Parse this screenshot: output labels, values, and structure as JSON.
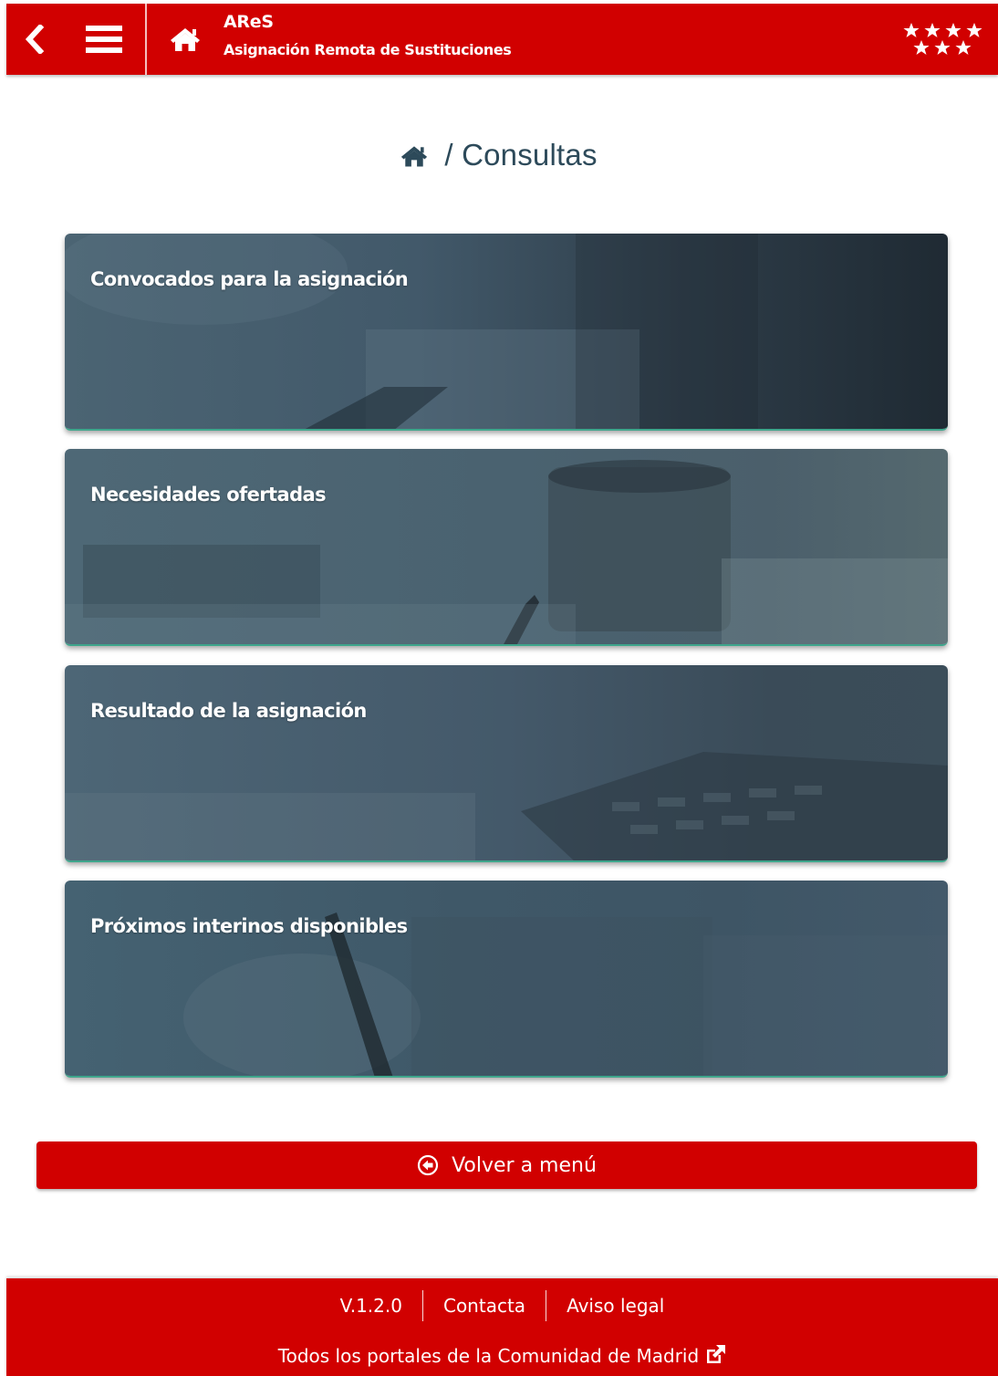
{
  "header": {
    "app_name": "AReS",
    "app_subtitle": "Asignación Remota de Sustituciones",
    "icons": [
      "chevron-left-icon",
      "hamburger-menu-icon",
      "home-icon",
      "stars-logo"
    ]
  },
  "breadcrumb": {
    "separator_and_title": "/ Consultas"
  },
  "cards": [
    {
      "title": "Convocados para la asignación"
    },
    {
      "title": "Necesidades ofertadas"
    },
    {
      "title": "Resultado de la asignación"
    },
    {
      "title": "Próximos interinos disponibles"
    }
  ],
  "back_button": {
    "label": "Volver a menú"
  },
  "footer": {
    "version": "V.1.2.0",
    "contact": "Contacta",
    "legal": "Aviso legal",
    "portals": "Todos los portales de la Comunidad de Madrid"
  },
  "colors": {
    "brand_red": "#d10000",
    "breadcrumb_text": "#2d4a5a",
    "card_accent": "#3fa68c"
  }
}
